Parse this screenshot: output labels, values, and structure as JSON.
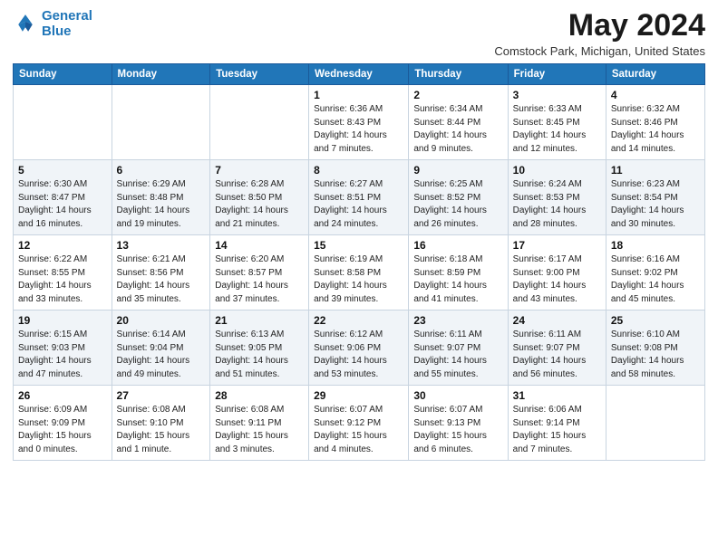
{
  "header": {
    "logo_line1": "General",
    "logo_line2": "Blue",
    "month_title": "May 2024",
    "location": "Comstock Park, Michigan, United States"
  },
  "days_of_week": [
    "Sunday",
    "Monday",
    "Tuesday",
    "Wednesday",
    "Thursday",
    "Friday",
    "Saturday"
  ],
  "weeks": [
    [
      {
        "num": "",
        "sunrise": "",
        "sunset": "",
        "daylight": ""
      },
      {
        "num": "",
        "sunrise": "",
        "sunset": "",
        "daylight": ""
      },
      {
        "num": "",
        "sunrise": "",
        "sunset": "",
        "daylight": ""
      },
      {
        "num": "1",
        "sunrise": "6:36 AM",
        "sunset": "8:43 PM",
        "daylight": "14 hours and 7 minutes"
      },
      {
        "num": "2",
        "sunrise": "6:34 AM",
        "sunset": "8:44 PM",
        "daylight": "14 hours and 9 minutes"
      },
      {
        "num": "3",
        "sunrise": "6:33 AM",
        "sunset": "8:45 PM",
        "daylight": "14 hours and 12 minutes"
      },
      {
        "num": "4",
        "sunrise": "6:32 AM",
        "sunset": "8:46 PM",
        "daylight": "14 hours and 14 minutes"
      }
    ],
    [
      {
        "num": "5",
        "sunrise": "6:30 AM",
        "sunset": "8:47 PM",
        "daylight": "14 hours and 16 minutes"
      },
      {
        "num": "6",
        "sunrise": "6:29 AM",
        "sunset": "8:48 PM",
        "daylight": "14 hours and 19 minutes"
      },
      {
        "num": "7",
        "sunrise": "6:28 AM",
        "sunset": "8:50 PM",
        "daylight": "14 hours and 21 minutes"
      },
      {
        "num": "8",
        "sunrise": "6:27 AM",
        "sunset": "8:51 PM",
        "daylight": "14 hours and 24 minutes"
      },
      {
        "num": "9",
        "sunrise": "6:25 AM",
        "sunset": "8:52 PM",
        "daylight": "14 hours and 26 minutes"
      },
      {
        "num": "10",
        "sunrise": "6:24 AM",
        "sunset": "8:53 PM",
        "daylight": "14 hours and 28 minutes"
      },
      {
        "num": "11",
        "sunrise": "6:23 AM",
        "sunset": "8:54 PM",
        "daylight": "14 hours and 30 minutes"
      }
    ],
    [
      {
        "num": "12",
        "sunrise": "6:22 AM",
        "sunset": "8:55 PM",
        "daylight": "14 hours and 33 minutes"
      },
      {
        "num": "13",
        "sunrise": "6:21 AM",
        "sunset": "8:56 PM",
        "daylight": "14 hours and 35 minutes"
      },
      {
        "num": "14",
        "sunrise": "6:20 AM",
        "sunset": "8:57 PM",
        "daylight": "14 hours and 37 minutes"
      },
      {
        "num": "15",
        "sunrise": "6:19 AM",
        "sunset": "8:58 PM",
        "daylight": "14 hours and 39 minutes"
      },
      {
        "num": "16",
        "sunrise": "6:18 AM",
        "sunset": "8:59 PM",
        "daylight": "14 hours and 41 minutes"
      },
      {
        "num": "17",
        "sunrise": "6:17 AM",
        "sunset": "9:00 PM",
        "daylight": "14 hours and 43 minutes"
      },
      {
        "num": "18",
        "sunrise": "6:16 AM",
        "sunset": "9:02 PM",
        "daylight": "14 hours and 45 minutes"
      }
    ],
    [
      {
        "num": "19",
        "sunrise": "6:15 AM",
        "sunset": "9:03 PM",
        "daylight": "14 hours and 47 minutes"
      },
      {
        "num": "20",
        "sunrise": "6:14 AM",
        "sunset": "9:04 PM",
        "daylight": "14 hours and 49 minutes"
      },
      {
        "num": "21",
        "sunrise": "6:13 AM",
        "sunset": "9:05 PM",
        "daylight": "14 hours and 51 minutes"
      },
      {
        "num": "22",
        "sunrise": "6:12 AM",
        "sunset": "9:06 PM",
        "daylight": "14 hours and 53 minutes"
      },
      {
        "num": "23",
        "sunrise": "6:11 AM",
        "sunset": "9:07 PM",
        "daylight": "14 hours and 55 minutes"
      },
      {
        "num": "24",
        "sunrise": "6:11 AM",
        "sunset": "9:07 PM",
        "daylight": "14 hours and 56 minutes"
      },
      {
        "num": "25",
        "sunrise": "6:10 AM",
        "sunset": "9:08 PM",
        "daylight": "14 hours and 58 minutes"
      }
    ],
    [
      {
        "num": "26",
        "sunrise": "6:09 AM",
        "sunset": "9:09 PM",
        "daylight": "15 hours and 0 minutes"
      },
      {
        "num": "27",
        "sunrise": "6:08 AM",
        "sunset": "9:10 PM",
        "daylight": "15 hours and 1 minute"
      },
      {
        "num": "28",
        "sunrise": "6:08 AM",
        "sunset": "9:11 PM",
        "daylight": "15 hours and 3 minutes"
      },
      {
        "num": "29",
        "sunrise": "6:07 AM",
        "sunset": "9:12 PM",
        "daylight": "15 hours and 4 minutes"
      },
      {
        "num": "30",
        "sunrise": "6:07 AM",
        "sunset": "9:13 PM",
        "daylight": "15 hours and 6 minutes"
      },
      {
        "num": "31",
        "sunrise": "6:06 AM",
        "sunset": "9:14 PM",
        "daylight": "15 hours and 7 minutes"
      },
      {
        "num": "",
        "sunrise": "",
        "sunset": "",
        "daylight": ""
      }
    ]
  ]
}
